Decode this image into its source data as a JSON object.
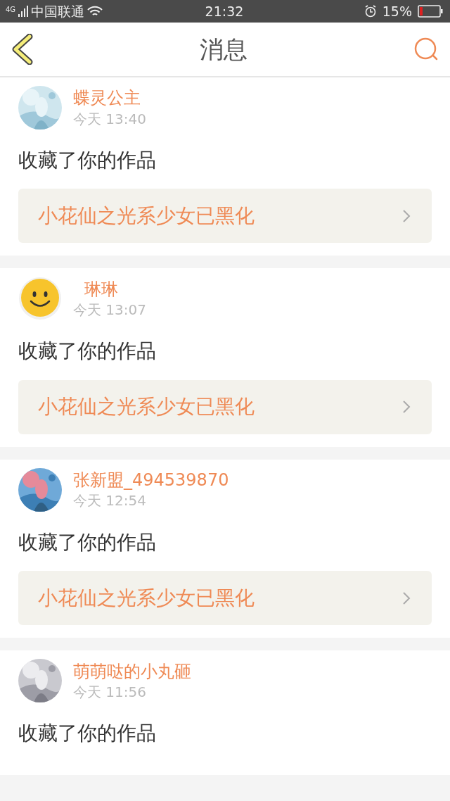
{
  "status_bar": {
    "network": "4G",
    "carrier": "中国联通",
    "time": "21:32",
    "battery": "15%"
  },
  "header": {
    "title": "消息"
  },
  "messages": [
    {
      "name": "蝶灵公主",
      "time": "今天 13:40",
      "action": "收藏了你的作品",
      "work": "小花仙之光系少女已黑化"
    },
    {
      "avatar": {
        "kind": "smiley"
      },
      "name": "琳琳",
      "time": "今天 13:07",
      "action": "收藏了你的作品",
      "work": "小花仙之光系少女已黑化"
    },
    {
      "name": "张新盟_494539870",
      "time": "今天 12:54",
      "action": "收藏了你的作品",
      "work": "小花仙之光系少女已黑化"
    },
    {
      "name": "萌萌哒的小丸砸",
      "time": "今天 11:56",
      "action": "收藏了你的作品"
    }
  ]
}
